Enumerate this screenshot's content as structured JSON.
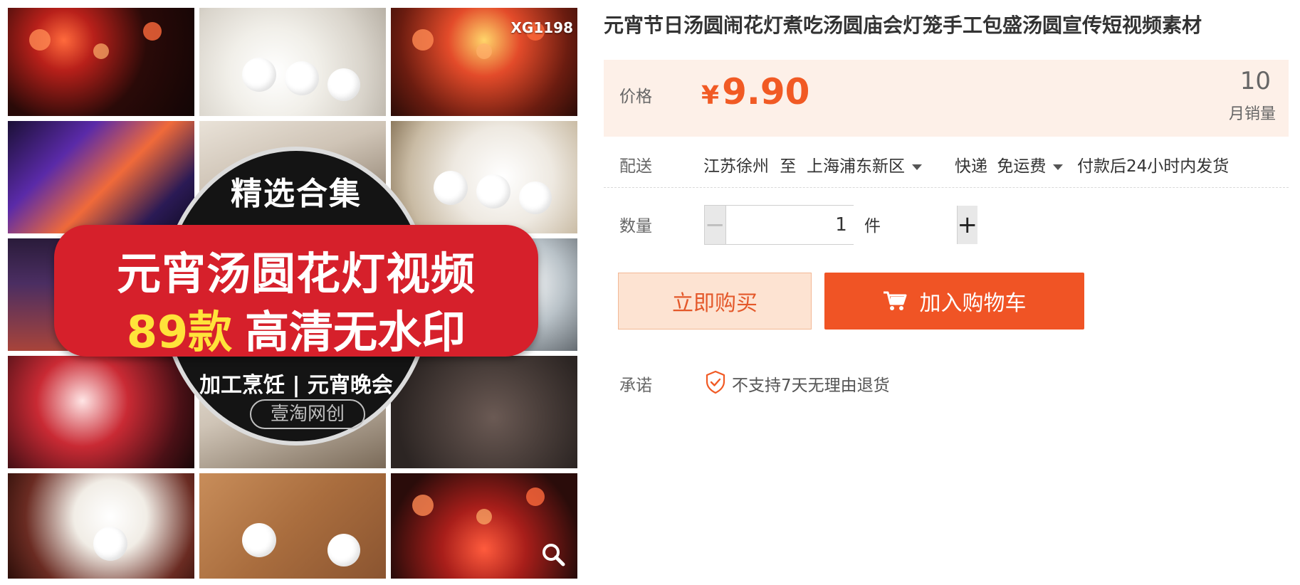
{
  "product": {
    "title": "元宵节日汤圆闹花灯煮吃汤圆庙会灯笼手工包盛汤圆宣传短视频素材",
    "image": {
      "code": "XG1198",
      "overlay_top": "精选合集",
      "banner_line1": "元宵汤圆花灯视频",
      "banner_count": "89款",
      "banner_line2": "高清无水印",
      "subtitle": "加工烹饪 | 元宵晚会",
      "stamp": "壹淘网创",
      "zoom_icon": "magnifier-icon"
    }
  },
  "price": {
    "label": "价格",
    "currency": "¥",
    "amount": "9.90",
    "sales_count": "10",
    "sales_label": "月销量",
    "accent_color": "#f15a24",
    "background_color": "#fdf0e8"
  },
  "delivery": {
    "label": "配送",
    "from": "江苏徐州",
    "to_word": "至",
    "destination": "上海浦东新区",
    "method": "快递",
    "shipping_fee": "免运费",
    "dispatch_note": "付款后24小时内发货"
  },
  "quantity": {
    "label": "数量",
    "value": "1",
    "minus_symbol": "−",
    "plus_symbol": "+",
    "unit": "件"
  },
  "actions": {
    "buy_now": "立即购买",
    "add_to_cart": "加入购物车",
    "cart_icon": "cart-icon",
    "primary_color": "#f05425"
  },
  "promise": {
    "label": "承诺",
    "text": "不支持7天无理由退货",
    "icon": "shield-check-icon"
  }
}
